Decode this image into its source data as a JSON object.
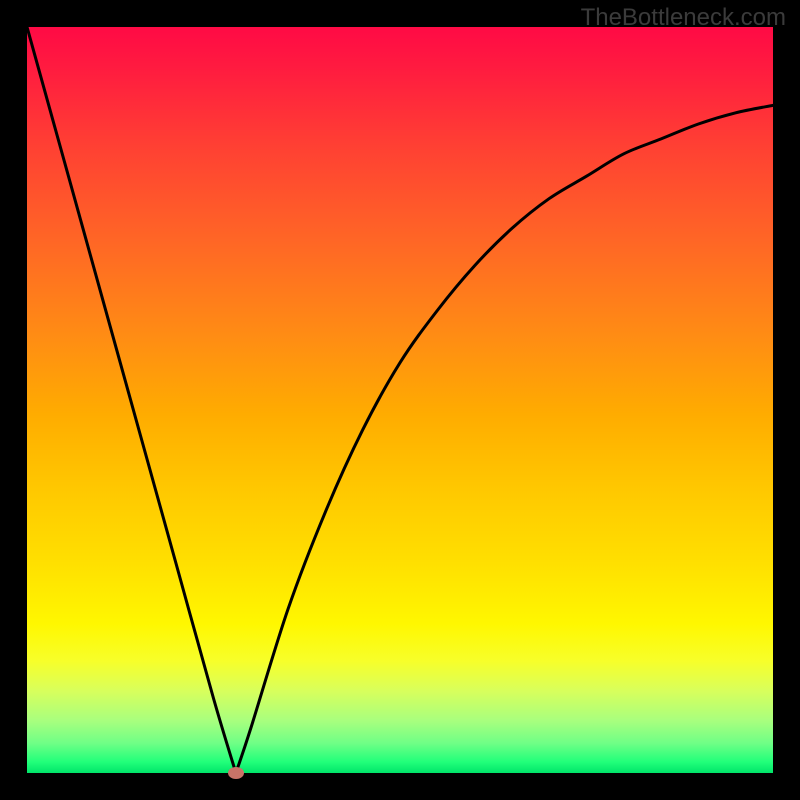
{
  "watermark": "TheBottleneck.com",
  "chart_data": {
    "type": "line",
    "title": "",
    "xlabel": "",
    "ylabel": "",
    "xlim": [
      0,
      100
    ],
    "ylim": [
      0,
      100
    ],
    "series": [
      {
        "name": "bottleneck-curve",
        "x": [
          0,
          5,
          10,
          15,
          20,
          25,
          28,
          30,
          35,
          40,
          45,
          50,
          55,
          60,
          65,
          70,
          75,
          80,
          85,
          90,
          95,
          100
        ],
        "values": [
          100,
          82,
          64,
          46,
          28,
          10,
          0,
          6,
          22,
          35,
          46,
          55,
          62,
          68,
          73,
          77,
          80,
          83,
          85,
          87,
          88.5,
          89.5
        ]
      }
    ],
    "marker": {
      "x": 28,
      "y": 0
    },
    "background_gradient": {
      "top_color": "#ff0a45",
      "bottom_color": "#00e56a"
    }
  }
}
